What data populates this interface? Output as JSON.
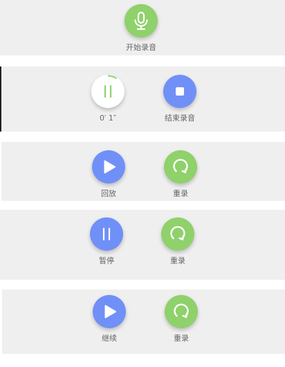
{
  "colors": {
    "panel_bg": "#efefef",
    "green_button": "#8fd16a",
    "blue_button": "#7090f8",
    "label_text": "#666666",
    "progress_arc": "#8fd16a"
  },
  "panel1": {
    "record_label": "开始录音",
    "record_icon": "microphone-icon"
  },
  "panel2": {
    "timer_text": "0′ 1″",
    "pause_icon": "pause-icon",
    "stop_label": "结束录音",
    "stop_icon": "stop-icon"
  },
  "panel3": {
    "play_label": "回放",
    "play_icon": "play-icon",
    "rerecord_label": "重录",
    "rerecord_icon": "rerecord-icon"
  },
  "panel4": {
    "pause_label": "暂停",
    "pause_icon": "pause-icon",
    "rerecord_label": "重录",
    "rerecord_icon": "rerecord-icon"
  },
  "panel5": {
    "continue_label": "继续",
    "continue_icon": "play-icon",
    "rerecord_label": "重录",
    "rerecord_icon": "rerecord-icon"
  }
}
